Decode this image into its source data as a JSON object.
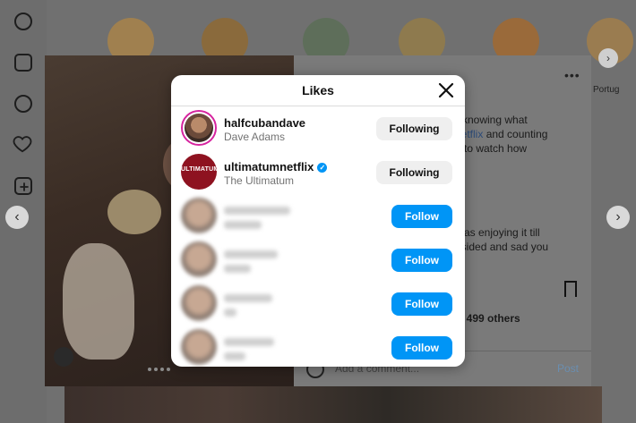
{
  "background": {
    "story_label": "Portug",
    "post": {
      "caption_line1": "knowing what",
      "caption_line2_link": "netflix",
      "caption_line2_rest": " and counting",
      "caption_line3": "to watch how",
      "comment_line1": "as enjoying it till",
      "comment_line2": "dsided and sad you",
      "likes_text": "d 499 others",
      "add_comment_placeholder": "Add a comment...",
      "post_button": "Post"
    }
  },
  "modal": {
    "title": "Likes",
    "close_icon": "close-icon",
    "rows": [
      {
        "username": "halfcubandave",
        "fullname": "Dave Adams",
        "button": "Following",
        "avatar": "photo"
      },
      {
        "username": "ultimatumnetflix",
        "fullname": "The Ultimatum",
        "button": "Following",
        "verified": true,
        "avatar": "logo",
        "avatar_text": "ULTIMATUM"
      },
      {
        "button": "Follow",
        "blurred": true
      },
      {
        "button": "Follow",
        "blurred": true
      },
      {
        "button": "Follow",
        "blurred": true
      },
      {
        "button": "Follow",
        "blurred": true
      }
    ]
  },
  "colors": {
    "follow_blue": "#0095f6",
    "following_gray": "#efefef",
    "story_ring": "#d6249f",
    "ultimatum_red": "#8e1220"
  }
}
